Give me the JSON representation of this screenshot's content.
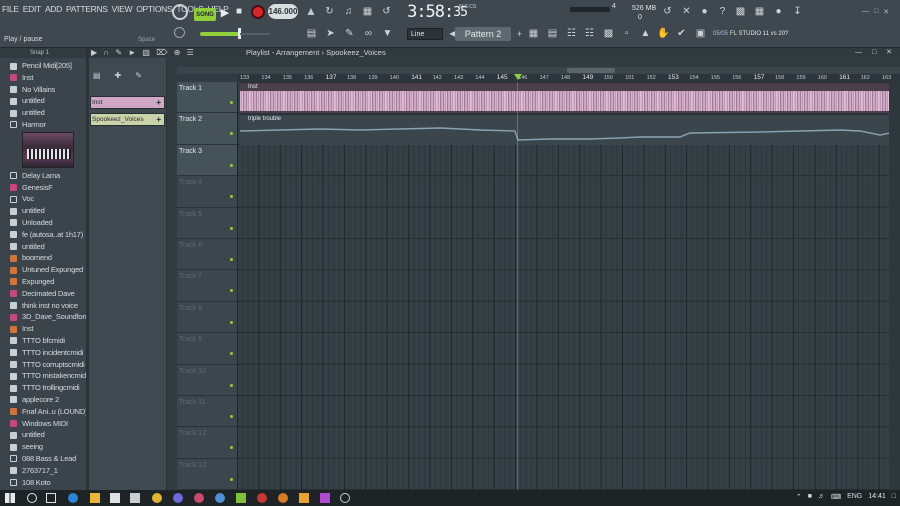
{
  "menu": [
    "FILE",
    "EDIT",
    "ADD",
    "PATTERNS",
    "VIEW",
    "OPTIONS",
    "TOOLS",
    "HELP"
  ],
  "hint": "Play / pause",
  "space": "Space",
  "transport": {
    "song": "SONG",
    "tempo": "146.000"
  },
  "clock": {
    "time": "3:58",
    "seconds": "35",
    "sub": "M:S:CS"
  },
  "cpu": {
    "cpu_value": "4",
    "mem": "526 MB",
    "poly": "0"
  },
  "snap": "Line",
  "pattern": "Pattern 2",
  "news": {
    "id": "05/05",
    "text": "FL STUDIO 11 vs 20?"
  },
  "browser": {
    "head": "Snap 1",
    "items": [
      {
        "label": "Pencil Midi[205]",
        "icon": "file-icon"
      },
      {
        "label": "Inst",
        "icon": "clip-red-icon"
      },
      {
        "label": "No Villains",
        "icon": "file-icon"
      },
      {
        "label": "untitled",
        "icon": "file-icon"
      },
      {
        "label": "untitled",
        "icon": "file-icon"
      },
      {
        "label": "Harmor",
        "icon": "gear-icon"
      },
      {
        "label": "Delay Lama",
        "icon": "gear-icon"
      },
      {
        "label": "GenesisF",
        "icon": "clip-red-icon"
      },
      {
        "label": "Voc",
        "icon": "gear-icon"
      },
      {
        "label": "untitled",
        "icon": "file-icon"
      },
      {
        "label": "Unloaded",
        "icon": "file-icon"
      },
      {
        "label": "fe (autosa..at 1h17)",
        "icon": "file-icon"
      },
      {
        "label": "untitled",
        "icon": "file-icon"
      },
      {
        "label": "boomend",
        "icon": "clip-orange-icon"
      },
      {
        "label": "Untuned Expunged",
        "icon": "clip-orange-icon"
      },
      {
        "label": "Expunged",
        "icon": "clip-orange-icon"
      },
      {
        "label": "Decimated Dave",
        "icon": "clip-red-icon"
      },
      {
        "label": "think inst no voice",
        "icon": "file-icon"
      },
      {
        "label": "3D_Dave_Soundfont",
        "icon": "clip-red-icon"
      },
      {
        "label": "Inst",
        "icon": "clip-orange-icon"
      },
      {
        "label": "TTTO bfcmidi",
        "icon": "file-icon"
      },
      {
        "label": "TTTO incidentcmidi",
        "icon": "file-icon"
      },
      {
        "label": "TTTO corruptscmidi",
        "icon": "file-icon"
      },
      {
        "label": "TTTO mistakencmidi",
        "icon": "file-icon"
      },
      {
        "label": "TTTO trollingcmidi",
        "icon": "file-icon"
      },
      {
        "label": "applecore 2",
        "icon": "file-icon"
      },
      {
        "label": "Fnaf Ani..u (LOUND)",
        "icon": "clip-orange-icon"
      },
      {
        "label": "Windows MIDI",
        "icon": "clip-red-icon"
      },
      {
        "label": "untitled",
        "icon": "file-icon"
      },
      {
        "label": "seeing",
        "icon": "file-icon"
      },
      {
        "label": "088 Bass & Lead",
        "icon": "gear-icon"
      },
      {
        "label": "2763717_1",
        "icon": "file-icon"
      },
      {
        "label": "108 Koto",
        "icon": "gear-icon"
      }
    ]
  },
  "playlist": {
    "title": "Playlist - Arrangement",
    "sep": "›",
    "current": "Spookeez_Voices",
    "patterns": [
      "Inst",
      "Spookeez_Voices"
    ],
    "ruler": [
      "133",
      "134",
      "135",
      "136",
      "137",
      "138",
      "139",
      "140",
      "141",
      "142",
      "143",
      "144",
      "145",
      "146",
      "147",
      "148",
      "149",
      "150",
      "151",
      "152",
      "153",
      "154",
      "155",
      "156",
      "157",
      "158",
      "159",
      "160",
      "161",
      "162",
      "163"
    ],
    "tracks": [
      "Track 1",
      "Track 2",
      "Track 3",
      "Track 4",
      "Track 5",
      "Track 6",
      "Track 7",
      "Track 8",
      "Track 9",
      "Track 10",
      "Track 11",
      "Track 12",
      "Track 13"
    ],
    "clips": {
      "inst": "Inst",
      "voice": "triple trouble"
    }
  },
  "taskbar": {
    "lang": "ENG",
    "time": "14:41"
  }
}
